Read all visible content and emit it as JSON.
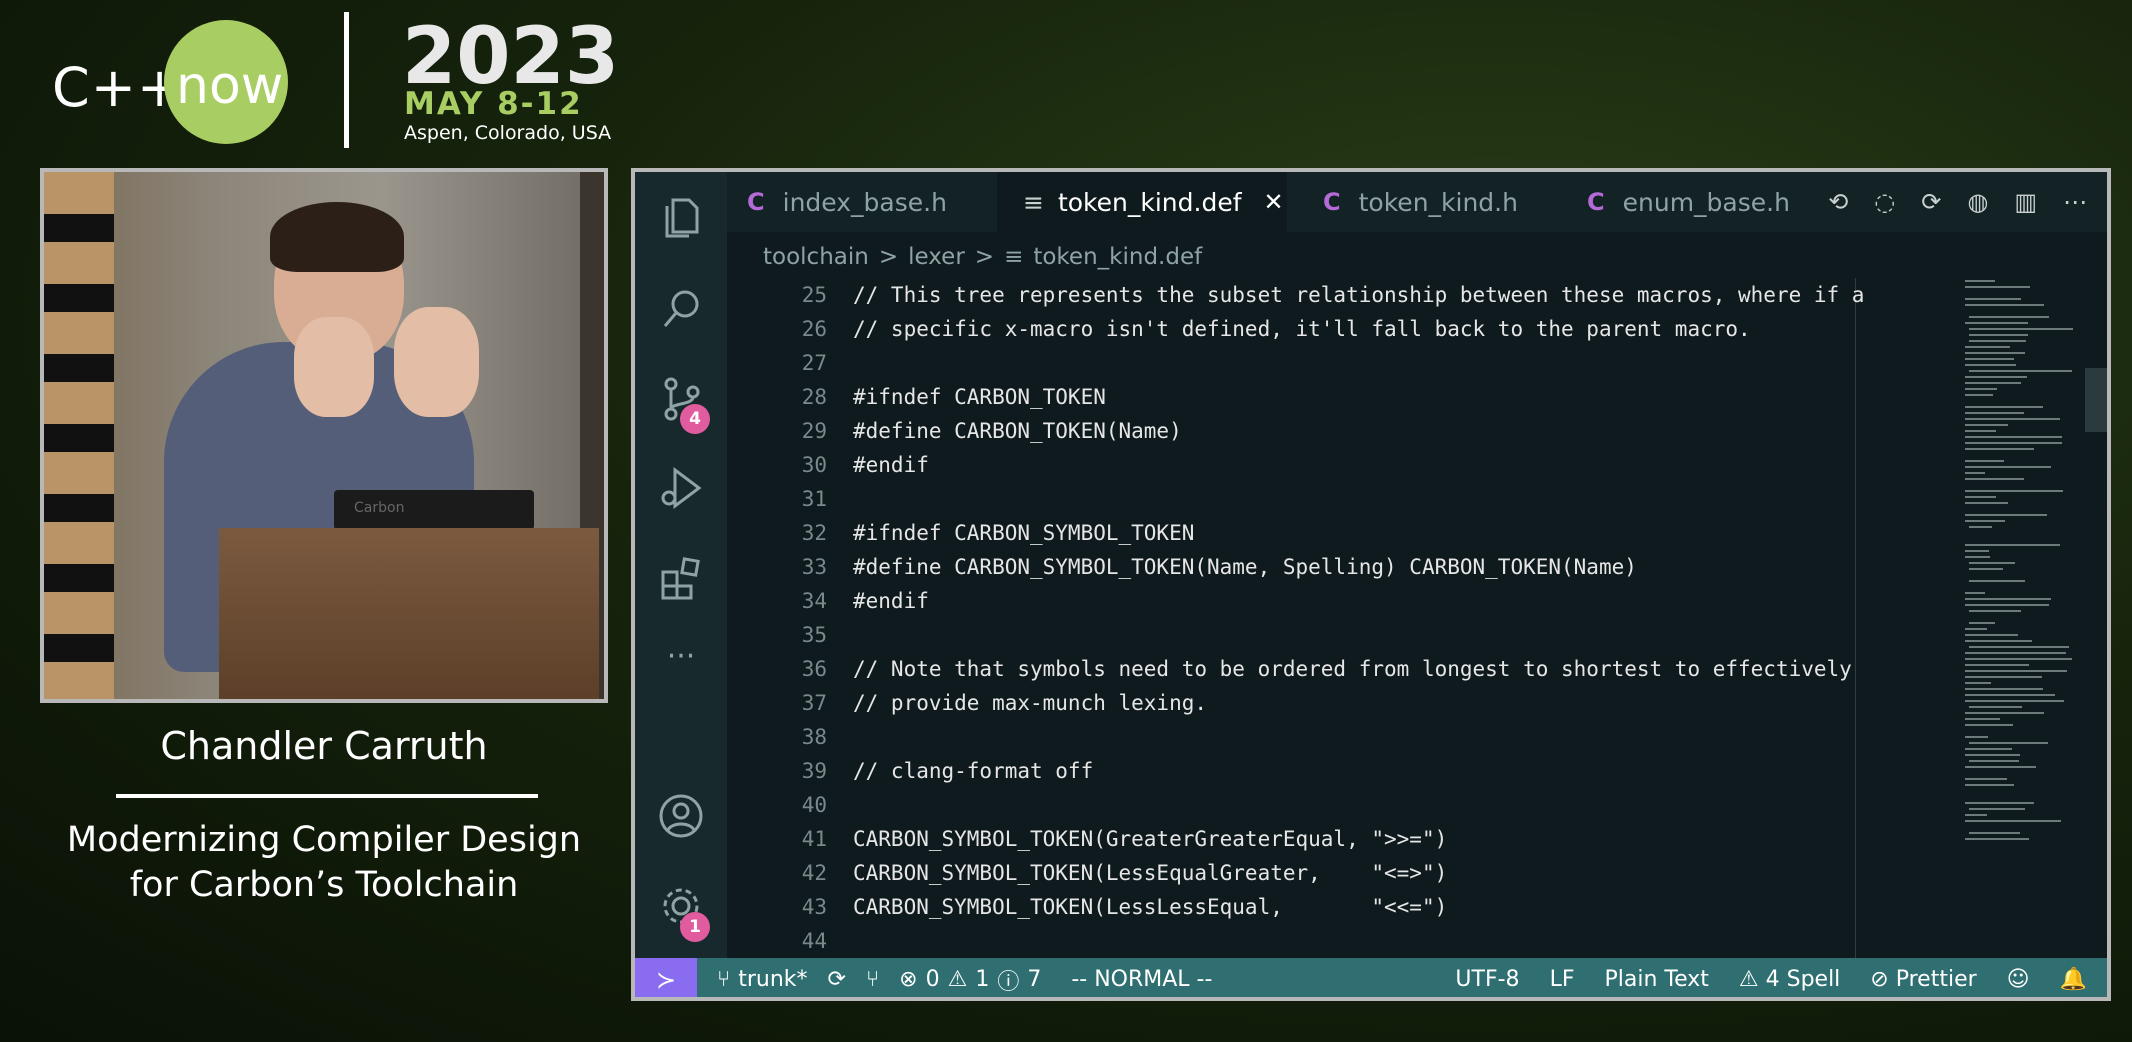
{
  "conference": {
    "cpp": "C++",
    "now": "now",
    "year": "2023",
    "dates": "MAY 8-12",
    "location": "Aspen, Colorado, USA"
  },
  "speaker": {
    "name": "Chandler Carruth",
    "talk_line1": "Modernizing Compiler Design",
    "talk_line2": "for Carbon’s Toolchain",
    "podium_label": "Carbon"
  },
  "editor": {
    "activity_bar": {
      "icons": [
        "files-icon",
        "search-icon",
        "source-control-icon",
        "run-debug-icon",
        "extensions-icon",
        "more-icon",
        "account-icon",
        "settings-gear-icon"
      ],
      "source_control_badge": "4",
      "settings_badge": "1"
    },
    "tabs": [
      {
        "label": "index_base.h",
        "icon": "C",
        "active": false
      },
      {
        "label": "token_kind.def",
        "icon": "≡",
        "active": true,
        "close": "✕"
      },
      {
        "label": "token_kind.h",
        "icon": "C",
        "active": false
      },
      {
        "label": "enum_base.h",
        "icon": "C",
        "active": false
      }
    ],
    "tab_tools": [
      "⟲",
      "◌",
      "⟳",
      "◍",
      "▥",
      "⋯"
    ],
    "breadcrumb": {
      "part1": "toolchain",
      "part2": "lexer",
      "part3": "token_kind.def",
      "sep": ">"
    },
    "code_lines": [
      {
        "n": "25",
        "t": "// This tree represents the subset relationship between these macros, where if a"
      },
      {
        "n": "26",
        "t": "// specific x-macro isn't defined, it'll fall back to the parent macro."
      },
      {
        "n": "27",
        "t": ""
      },
      {
        "n": "28",
        "t": "#ifndef CARBON_TOKEN"
      },
      {
        "n": "29",
        "t": "#define CARBON_TOKEN(Name)"
      },
      {
        "n": "30",
        "t": "#endif"
      },
      {
        "n": "31",
        "t": ""
      },
      {
        "n": "32",
        "t": "#ifndef CARBON_SYMBOL_TOKEN"
      },
      {
        "n": "33",
        "t": "#define CARBON_SYMBOL_TOKEN(Name, Spelling) CARBON_TOKEN(Name)"
      },
      {
        "n": "34",
        "t": "#endif"
      },
      {
        "n": "35",
        "t": ""
      },
      {
        "n": "36",
        "t": "// Note that symbols need to be ordered from longest to shortest to effectively"
      },
      {
        "n": "37",
        "t": "// provide max-munch lexing."
      },
      {
        "n": "38",
        "t": ""
      },
      {
        "n": "39",
        "t": "// clang-format off"
      },
      {
        "n": "40",
        "t": ""
      },
      {
        "n": "41",
        "t": "CARBON_SYMBOL_TOKEN(GreaterGreaterEqual, \">>=\")"
      },
      {
        "n": "42",
        "t": "CARBON_SYMBOL_TOKEN(LessEqualGreater,    \"<=>\")"
      },
      {
        "n": "43",
        "t": "CARBON_SYMBOL_TOKEN(LessLessEqual,       \"<<=\")"
      },
      {
        "n": "44",
        "t": ""
      }
    ],
    "status": {
      "remote": "≻",
      "branch": "trunk*",
      "sync": "⟳",
      "graph": "⑂",
      "errors": "0",
      "warnings": "1",
      "info": "7",
      "mode": "-- NORMAL --",
      "encoding": "UTF-8",
      "eol": "LF",
      "language": "Plain Text",
      "spell": "4 Spell",
      "formatter": "Prettier"
    },
    "colors": {
      "background": "#0e1a1d",
      "activity_bar": "#17292c",
      "status_bar": "#2f6f72",
      "remote_button": "#8a6cf0",
      "badge": "#e05c9e",
      "c_icon": "#b56ad8"
    }
  }
}
